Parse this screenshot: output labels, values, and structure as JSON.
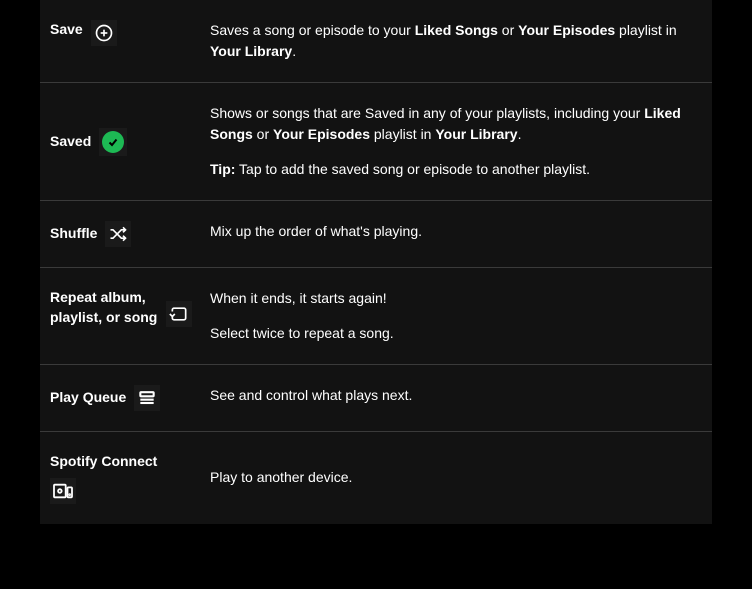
{
  "rows": {
    "save": {
      "label": "Save",
      "desc_parts": [
        "Saves a song or episode to your ",
        "Liked Songs",
        " or ",
        "Your Episodes",
        " playlist in ",
        "Your Library",
        "."
      ]
    },
    "saved": {
      "label": "Saved",
      "desc1_parts": [
        "Shows or songs that are Saved in any of your playlists, including your ",
        "Liked Songs",
        " or ",
        "Your Episodes",
        " playlist in ",
        "Your Library",
        "."
      ],
      "desc2_parts": [
        "Tip:",
        " Tap to add the saved song or episode to another playlist."
      ]
    },
    "shuffle": {
      "label": "Shuffle",
      "desc": "Mix up the order of what's playing."
    },
    "repeat": {
      "label": "Repeat album, playlist, or song",
      "desc1": "When it ends, it starts again!",
      "desc2": "Select twice to repeat a song."
    },
    "queue": {
      "label": "Play Queue",
      "desc": "See and control what plays next."
    },
    "connect": {
      "label": "Spotify Connect",
      "desc": "Play to another device."
    }
  }
}
